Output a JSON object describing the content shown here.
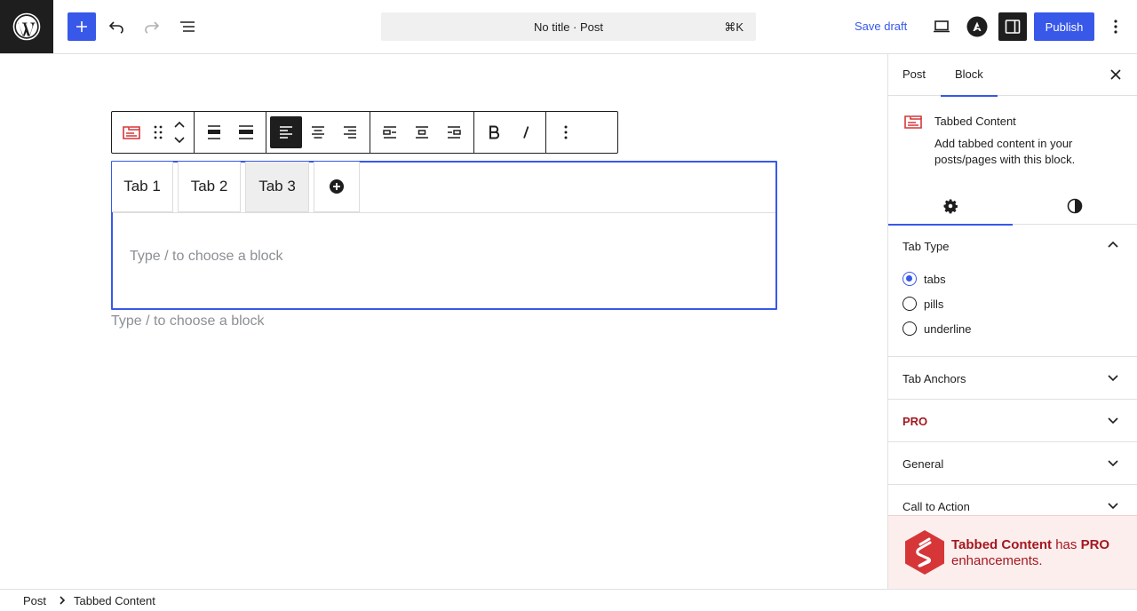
{
  "header": {
    "command_bar": {
      "title": "No title · Post",
      "shortcut": "⌘K"
    },
    "save_draft_label": "Save draft",
    "publish_label": "Publish",
    "icons": {
      "logo": "wordpress-logo-icon",
      "inserter": "plus-icon",
      "undo": "undo-icon",
      "redo": "redo-icon",
      "document_overview": "list-view-icon",
      "preview": "laptop-preview-icon",
      "astra": "astra-logo-icon",
      "settings": "sidebar-toggle-icon",
      "options": "kebab-menu-icon"
    },
    "accent_color": "#3858e9"
  },
  "editor": {
    "tabs": [
      {
        "label": "Tab 1"
      },
      {
        "label": "Tab 2"
      },
      {
        "label": "Tab 3",
        "active": true
      }
    ],
    "tab_content_placeholder": "Type / to choose a block",
    "below_placeholder": "Type / to choose a block"
  },
  "sidebar": {
    "tabs": {
      "post": "Post",
      "block": "Block"
    },
    "active_tab": "Block",
    "block_card": {
      "title": "Tabbed Content",
      "description": "Add tabbed content in your posts/pages with this block."
    },
    "panel_tabs": [
      "settings",
      "style"
    ],
    "tab_type": {
      "title": "Tab Type",
      "options": [
        {
          "label": "tabs",
          "checked": true
        },
        {
          "label": "pills",
          "checked": false
        },
        {
          "label": "underline",
          "checked": false
        }
      ]
    },
    "sections": {
      "tab_anchors": "Tab Anchors",
      "pro": "PRO",
      "general": "General",
      "call_to_action": "Call to Action"
    },
    "pro_banner": {
      "block_name": "Tabbed Content",
      "has": "has",
      "pro": "PRO",
      "enhancements": "enhancements."
    },
    "pro_color": "#a3181f"
  },
  "footer": {
    "breadcrumb": [
      "Post",
      "Tabbed Content"
    ]
  }
}
